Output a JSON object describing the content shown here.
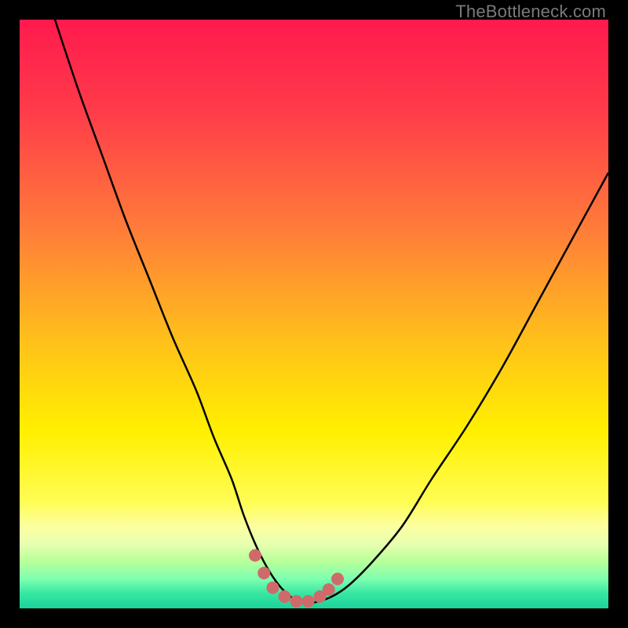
{
  "watermark": "TheBottleneck.com",
  "colors": {
    "black": "#000000",
    "curve": "#000000",
    "dots": "#cf6a6a",
    "gradient_stops": [
      {
        "offset": 0.0,
        "color": "#ff1a4d"
      },
      {
        "offset": 0.15,
        "color": "#ff3a4a"
      },
      {
        "offset": 0.35,
        "color": "#ff7a3a"
      },
      {
        "offset": 0.55,
        "color": "#ffc21a"
      },
      {
        "offset": 0.7,
        "color": "#fff000"
      },
      {
        "offset": 0.82,
        "color": "#fffd55"
      },
      {
        "offset": 0.86,
        "color": "#fcffa0"
      },
      {
        "offset": 0.89,
        "color": "#e8ffb0"
      },
      {
        "offset": 0.92,
        "color": "#b8ff9a"
      },
      {
        "offset": 0.95,
        "color": "#7dffb0"
      },
      {
        "offset": 0.975,
        "color": "#36e6a2"
      },
      {
        "offset": 1.0,
        "color": "#1cd39a"
      }
    ]
  },
  "chart_data": {
    "type": "line",
    "title": "",
    "xlabel": "",
    "ylabel": "",
    "xlim": [
      0,
      100
    ],
    "ylim": [
      0,
      100
    ],
    "series": [
      {
        "name": "bottleneck-curve",
        "x": [
          6,
          10,
          14,
          18,
          22,
          26,
          30,
          33,
          36,
          38,
          40,
          42,
          44,
          46,
          48,
          50,
          53,
          56,
          60,
          65,
          70,
          76,
          82,
          88,
          94,
          100
        ],
        "y": [
          100,
          88,
          77,
          66,
          56,
          46,
          37,
          29,
          22,
          16,
          11,
          7,
          4,
          2,
          1,
          1,
          2,
          4,
          8,
          14,
          22,
          31,
          41,
          52,
          63,
          74
        ]
      }
    ],
    "annotations": {
      "valley_dots": [
        {
          "x": 40,
          "y": 9
        },
        {
          "x": 41.5,
          "y": 6
        },
        {
          "x": 43,
          "y": 3.5
        },
        {
          "x": 45,
          "y": 2
        },
        {
          "x": 47,
          "y": 1.2
        },
        {
          "x": 49,
          "y": 1.2
        },
        {
          "x": 51,
          "y": 2
        },
        {
          "x": 52.5,
          "y": 3.2
        },
        {
          "x": 54,
          "y": 5
        }
      ]
    }
  }
}
